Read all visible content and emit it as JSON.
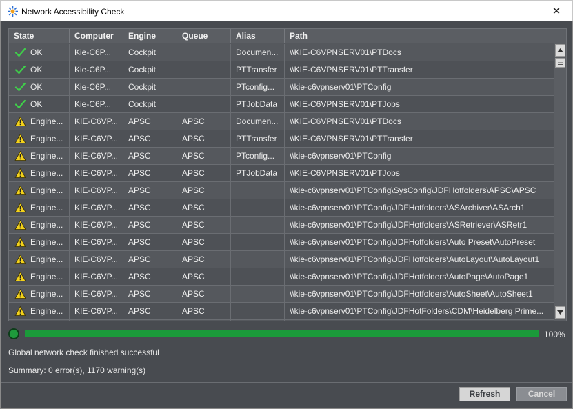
{
  "window": {
    "title": "Network Accessibility Check",
    "close_glyph": "✕"
  },
  "table": {
    "columns": [
      "State",
      "Computer",
      "Engine",
      "Queue",
      "Alias",
      "Path"
    ],
    "rows": [
      {
        "state_icon": "check-icon",
        "state": "OK",
        "computer": "Kie-C6P...",
        "engine": "Cockpit",
        "queue": "",
        "alias": "Documen...",
        "path": "\\\\KIE-C6VPNSERV01\\PTDocs"
      },
      {
        "state_icon": "check-icon",
        "state": "OK",
        "computer": "Kie-C6P...",
        "engine": "Cockpit",
        "queue": "",
        "alias": "PTTransfer",
        "path": "\\\\KIE-C6VPNSERV01\\PTTransfer"
      },
      {
        "state_icon": "check-icon",
        "state": "OK",
        "computer": "Kie-C6P...",
        "engine": "Cockpit",
        "queue": "",
        "alias": "PTconfig...",
        "path": "\\\\kie-c6vpnserv01\\PTConfig"
      },
      {
        "state_icon": "check-icon",
        "state": "OK",
        "computer": "Kie-C6P...",
        "engine": "Cockpit",
        "queue": "",
        "alias": "PTJobData",
        "path": "\\\\KIE-C6VPNSERV01\\PTJobs"
      },
      {
        "state_icon": "warning-icon",
        "state": "Engine...",
        "computer": "KIE-C6VP...",
        "engine": "APSC",
        "queue": "APSC",
        "alias": "Documen...",
        "path": "\\\\KIE-C6VPNSERV01\\PTDocs"
      },
      {
        "state_icon": "warning-icon",
        "state": "Engine...",
        "computer": "KIE-C6VP...",
        "engine": "APSC",
        "queue": "APSC",
        "alias": "PTTransfer",
        "path": "\\\\KIE-C6VPNSERV01\\PTTransfer"
      },
      {
        "state_icon": "warning-icon",
        "state": "Engine...",
        "computer": "KIE-C6VP...",
        "engine": "APSC",
        "queue": "APSC",
        "alias": "PTconfig...",
        "path": "\\\\kie-c6vpnserv01\\PTConfig"
      },
      {
        "state_icon": "warning-icon",
        "state": "Engine...",
        "computer": "KIE-C6VP...",
        "engine": "APSC",
        "queue": "APSC",
        "alias": "PTJobData",
        "path": "\\\\KIE-C6VPNSERV01\\PTJobs"
      },
      {
        "state_icon": "warning-icon",
        "state": "Engine...",
        "computer": "KIE-C6VP...",
        "engine": "APSC",
        "queue": "APSC",
        "alias": "",
        "path": "\\\\kie-c6vpnserv01\\PTConfig\\SysConfig\\JDFHotfolders\\APSC\\APSC"
      },
      {
        "state_icon": "warning-icon",
        "state": "Engine...",
        "computer": "KIE-C6VP...",
        "engine": "APSC",
        "queue": "APSC",
        "alias": "",
        "path": "\\\\kie-c6vpnserv01\\PTConfig\\JDFHotfolders\\ASArchiver\\ASArch1"
      },
      {
        "state_icon": "warning-icon",
        "state": "Engine...",
        "computer": "KIE-C6VP...",
        "engine": "APSC",
        "queue": "APSC",
        "alias": "",
        "path": "\\\\kie-c6vpnserv01\\PTConfig\\JDFHotfolders\\ASRetriever\\ASRetr1"
      },
      {
        "state_icon": "warning-icon",
        "state": "Engine...",
        "computer": "KIE-C6VP...",
        "engine": "APSC",
        "queue": "APSC",
        "alias": "",
        "path": "\\\\kie-c6vpnserv01\\PTConfig\\JDFHotfolders\\Auto Preset\\AutoPreset"
      },
      {
        "state_icon": "warning-icon",
        "state": "Engine...",
        "computer": "KIE-C6VP...",
        "engine": "APSC",
        "queue": "APSC",
        "alias": "",
        "path": "\\\\kie-c6vpnserv01\\PTConfig\\JDFHotfolders\\AutoLayout\\AutoLayout1"
      },
      {
        "state_icon": "warning-icon",
        "state": "Engine...",
        "computer": "KIE-C6VP...",
        "engine": "APSC",
        "queue": "APSC",
        "alias": "",
        "path": "\\\\kie-c6vpnserv01\\PTConfig\\JDFHotfolders\\AutoPage\\AutoPage1"
      },
      {
        "state_icon": "warning-icon",
        "state": "Engine...",
        "computer": "KIE-C6VP...",
        "engine": "APSC",
        "queue": "APSC",
        "alias": "",
        "path": "\\\\kie-c6vpnserv01\\PTConfig\\JDFHotfolders\\AutoSheet\\AutoSheet1"
      },
      {
        "state_icon": "warning-icon",
        "state": "Engine...",
        "computer": "KIE-C6VP...",
        "engine": "APSC",
        "queue": "APSC",
        "alias": "",
        "path": "\\\\kie-c6vpnserv01\\PTConfig\\JDFHotFolders\\CDM\\Heidelberg Prime..."
      },
      {
        "state_icon": "warning-icon",
        "state": "",
        "computer": "",
        "engine": "",
        "queue": "",
        "alias": "",
        "path": ""
      }
    ]
  },
  "progress": {
    "value": 1.0,
    "label": "100%",
    "color": "#1b9a3a"
  },
  "status": {
    "message": "Global network check finished successful",
    "summary": "Summary: 0 error(s), 1170 warning(s)"
  },
  "buttons": {
    "refresh": "Refresh",
    "cancel": "Cancel"
  }
}
